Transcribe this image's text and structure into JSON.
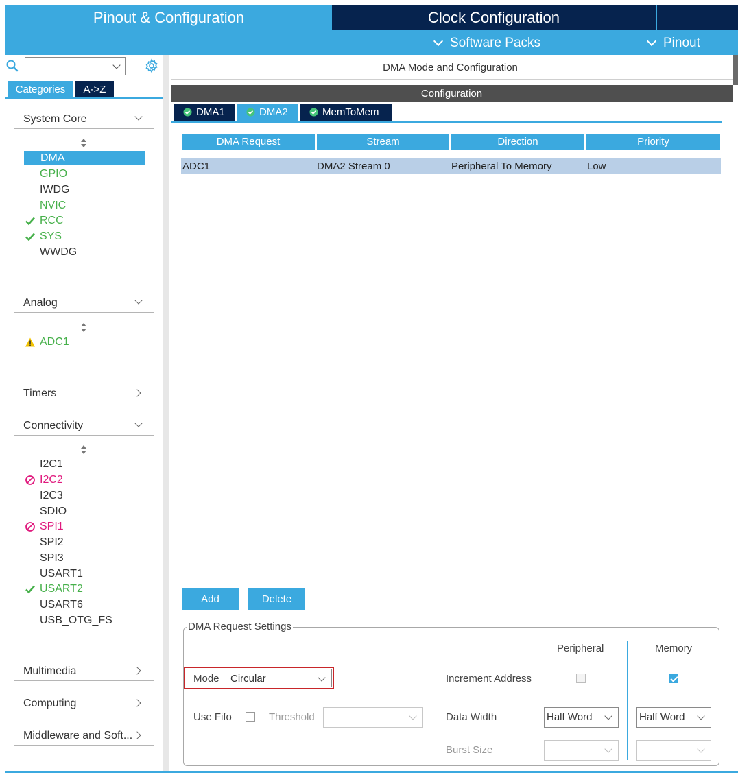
{
  "header": {
    "tab_pinout": "Pinout & Configuration",
    "tab_clock": "Clock Configuration",
    "menu_software_packs": "Software Packs",
    "menu_pinout": "Pinout"
  },
  "sidebar": {
    "search_value": "",
    "view_categories": "Categories",
    "view_az": "A->Z",
    "categories": [
      {
        "label": "System Core",
        "expanded": true
      },
      {
        "label": "Analog",
        "expanded": true
      },
      {
        "label": "Timers",
        "expanded": false
      },
      {
        "label": "Connectivity",
        "expanded": true
      },
      {
        "label": "Multimedia",
        "expanded": false
      },
      {
        "label": "Computing",
        "expanded": false
      },
      {
        "label": "Middleware and Soft...",
        "expanded": false
      }
    ],
    "system_core_items": [
      {
        "label": "DMA",
        "status": "selected"
      },
      {
        "label": "GPIO",
        "status": "green"
      },
      {
        "label": "IWDG",
        "status": "none"
      },
      {
        "label": "NVIC",
        "status": "green"
      },
      {
        "label": "RCC",
        "status": "ok"
      },
      {
        "label": "SYS",
        "status": "ok"
      },
      {
        "label": "WWDG",
        "status": "none"
      }
    ],
    "analog_items": [
      {
        "label": "ADC1",
        "status": "warning"
      }
    ],
    "connectivity_items": [
      {
        "label": "I2C1",
        "status": "none"
      },
      {
        "label": "I2C2",
        "status": "disabled"
      },
      {
        "label": "I2C3",
        "status": "none"
      },
      {
        "label": "SDIO",
        "status": "none"
      },
      {
        "label": "SPI1",
        "status": "disabled"
      },
      {
        "label": "SPI2",
        "status": "none"
      },
      {
        "label": "SPI3",
        "status": "none"
      },
      {
        "label": "USART1",
        "status": "none"
      },
      {
        "label": "USART2",
        "status": "ok"
      },
      {
        "label": "USART6",
        "status": "none"
      },
      {
        "label": "USB_OTG_FS",
        "status": "none"
      }
    ]
  },
  "main": {
    "title": "DMA Mode and Configuration",
    "config_label": "Configuration",
    "tabs": [
      {
        "label": "DMA1",
        "active": false
      },
      {
        "label": "DMA2",
        "active": true
      },
      {
        "label": "MemToMem",
        "active": false
      }
    ],
    "table": {
      "headers": [
        "DMA Request",
        "Stream",
        "Direction",
        "Priority"
      ],
      "rows": [
        [
          "ADC1",
          "DMA2 Stream 0",
          "Peripheral To Memory",
          "Low"
        ]
      ]
    },
    "add_label": "Add",
    "delete_label": "Delete",
    "settings": {
      "legend": "DMA Request Settings",
      "peripheral_label": "Peripheral",
      "memory_label": "Memory",
      "mode_label": "Mode",
      "mode_value": "Circular",
      "increment_label": "Increment Address",
      "increment_peripheral": false,
      "increment_memory": true,
      "use_fifo_label": "Use Fifo",
      "use_fifo": false,
      "threshold_label": "Threshold",
      "threshold_value": "",
      "data_width_label": "Data Width",
      "data_width_peripheral": "Half Word",
      "data_width_memory": "Half Word",
      "burst_size_label": "Burst Size",
      "burst_peripheral": "",
      "burst_memory": ""
    }
  },
  "colors": {
    "accent": "#3ba9df",
    "navy": "#06234e",
    "ok_green": "#46b04a",
    "disabled_pink": "#e0197d",
    "warning_yellow": "#f2c200"
  }
}
